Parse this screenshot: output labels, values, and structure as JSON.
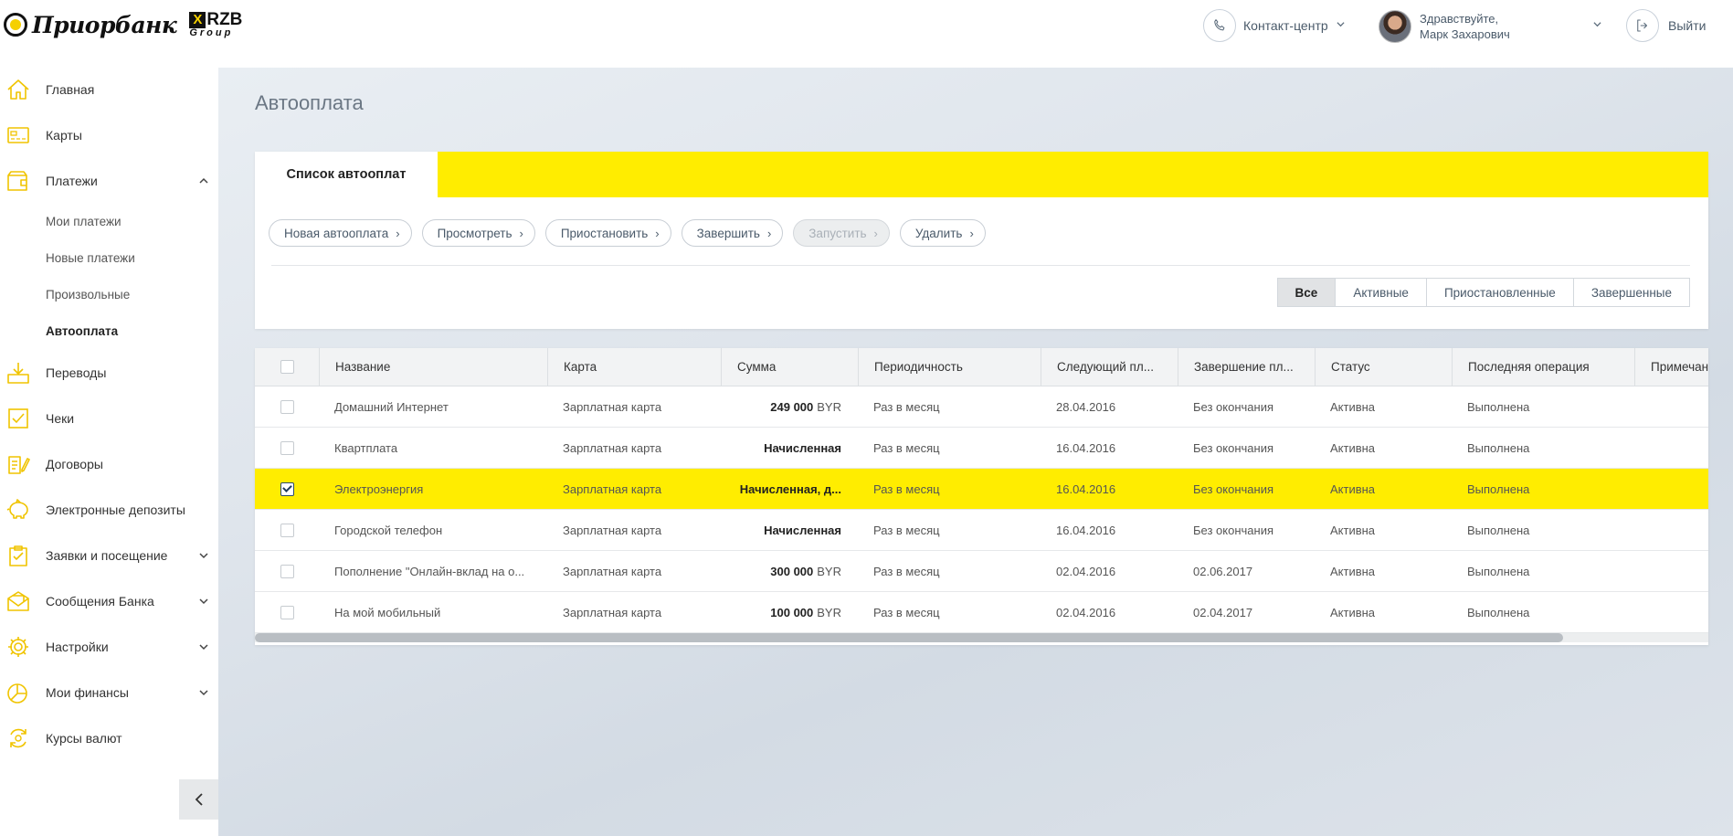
{
  "header": {
    "logo_text": "Приорбанк",
    "rzb_mark": "X",
    "rzb_word": "RZB",
    "rzb_group": "Group",
    "contact_label": "Контакт-центр",
    "greeting": "Здравствуйте,",
    "user_name": "Марк Захарович",
    "logout_label": "Выйти"
  },
  "sidebar": {
    "items": [
      {
        "label": "Главная",
        "icon": "home-icon"
      },
      {
        "label": "Карты",
        "icon": "card-icon"
      },
      {
        "label": "Платежи",
        "icon": "wallet-icon",
        "expanded": true
      },
      {
        "label": "Переводы",
        "icon": "transfer-icon"
      },
      {
        "label": "Чеки",
        "icon": "receipt-icon"
      },
      {
        "label": "Договоры",
        "icon": "contract-icon"
      },
      {
        "label": "Электронные депозиты",
        "icon": "piggy-bank-icon"
      },
      {
        "label": "Заявки и посещение",
        "icon": "clipboard-icon",
        "expandable": true
      },
      {
        "label": "Сообщения Банка",
        "icon": "mail-icon",
        "expandable": true
      },
      {
        "label": "Настройки",
        "icon": "gear-icon",
        "expandable": true
      },
      {
        "label": "Мои финансы",
        "icon": "pie-chart-icon",
        "expandable": true
      },
      {
        "label": "Курсы валют",
        "icon": "currency-exchange-icon"
      }
    ],
    "payments_sub": [
      {
        "label": "Мои платежи"
      },
      {
        "label": "Новые платежи"
      },
      {
        "label": "Произвольные"
      },
      {
        "label": "Автооплата",
        "active": true
      }
    ]
  },
  "main": {
    "page_title": "Автооплата",
    "tab_label": "Список автооплат",
    "toolbar": [
      {
        "label": "Новая автооплата",
        "disabled": false
      },
      {
        "label": "Просмотреть",
        "disabled": false
      },
      {
        "label": "Приостановить",
        "disabled": false
      },
      {
        "label": "Завершить",
        "disabled": false
      },
      {
        "label": "Запустить",
        "disabled": true
      },
      {
        "label": "Удалить",
        "disabled": false
      }
    ],
    "filters": [
      {
        "label": "Все",
        "active": true
      },
      {
        "label": "Активные",
        "active": false
      },
      {
        "label": "Приостановленные",
        "active": false
      },
      {
        "label": "Завершенные",
        "active": false
      }
    ]
  },
  "table": {
    "columns": [
      "Название",
      "Карта",
      "Сумма",
      "Периодичность",
      "Следующий пл...",
      "Завершение пл...",
      "Статус",
      "Последняя операция",
      "Примечание"
    ],
    "rows": [
      {
        "name": "Домашний Интернет",
        "card": "Зарплатная карта",
        "amount": "249 000",
        "currency": "BYR",
        "period": "Раз в месяц",
        "next": "28.04.2016",
        "end": "Без окончания",
        "status": "Активна",
        "last_op": "Выполнена",
        "note": "",
        "checked": false,
        "selected": false
      },
      {
        "name": "Квартплата",
        "card": "Зарплатная карта",
        "amount": "Начисленная",
        "currency": "",
        "period": "Раз в месяц",
        "next": "16.04.2016",
        "end": "Без окончания",
        "status": "Активна",
        "last_op": "Выполнена",
        "note": "",
        "checked": false,
        "selected": false
      },
      {
        "name": "Электроэнергия",
        "card": "Зарплатная карта",
        "amount": "Начисленная, д...",
        "currency": "",
        "period": "Раз в месяц",
        "next": "16.04.2016",
        "end": "Без окончания",
        "status": "Активна",
        "last_op": "Выполнена",
        "note": "",
        "checked": true,
        "selected": true
      },
      {
        "name": "Городской телефон",
        "card": "Зарплатная карта",
        "amount": "Начисленная",
        "currency": "",
        "period": "Раз в месяц",
        "next": "16.04.2016",
        "end": "Без окончания",
        "status": "Активна",
        "last_op": "Выполнена",
        "note": "",
        "checked": false,
        "selected": false
      },
      {
        "name": "Пополнение \"Онлайн-вклад на о...",
        "card": "Зарплатная карта",
        "amount": "300 000",
        "currency": "BYR",
        "period": "Раз в месяц",
        "next": "02.04.2016",
        "end": "02.06.2017",
        "status": "Активна",
        "last_op": "Выполнена",
        "note": "",
        "checked": false,
        "selected": false
      },
      {
        "name": "На мой мобильный",
        "card": "Зарплатная карта",
        "amount": "100 000",
        "currency": "BYR",
        "period": "Раз в месяц",
        "next": "02.04.2016",
        "end": "02.04.2017",
        "status": "Активна",
        "last_op": "Выполнена",
        "note": "",
        "checked": false,
        "selected": false
      }
    ],
    "horizontal_scroll_fraction": 0.9
  },
  "colors": {
    "brand_yellow": "#ffed00",
    "icon_yellow": "#f0c400",
    "text_dark": "#333333"
  }
}
